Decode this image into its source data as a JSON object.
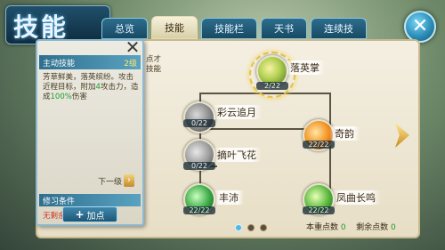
{
  "title": "技能",
  "tabs": [
    {
      "label": "总览"
    },
    {
      "label": "技能",
      "active": true
    },
    {
      "label": "技能栏"
    },
    {
      "label": "天书"
    },
    {
      "label": "连续技"
    }
  ],
  "info": {
    "header_left": "主动技能",
    "header_right": "2级",
    "desc_line1": "芳草鲜美，落英缤纷。攻击近程目标，附加",
    "desc_highlight_1": "4",
    "desc_line2": "攻击力，造成",
    "desc_highlight_2": "100%",
    "desc_line3": "伤害",
    "next_level": "下一级",
    "req_header": "修习条件",
    "req_text": "无剩余点数，无法修习",
    "add_button": "加点"
  },
  "partial_text": [
    "点才",
    "技能"
  ],
  "skills": [
    {
      "name": "落英掌",
      "count": "2/22",
      "color": "#8bb441"
    },
    {
      "name": "彩云追月",
      "count": "0/22",
      "color": "#9a9a9a"
    },
    {
      "name": "奇韵",
      "count": "22/22",
      "color": "#d4741b"
    },
    {
      "name": "摘叶飞花",
      "count": "0/22",
      "color": "#9a9a9a"
    },
    {
      "name": "丰沛",
      "count": "22/22",
      "color": "#3aa845"
    },
    {
      "name": "凤曲长鸣",
      "count": "22/22",
      "color": "#56b63b"
    }
  ],
  "points": {
    "current_label": "本重点数",
    "current_value": "0",
    "remain_label": "剩余点数",
    "remain_value": "0"
  },
  "pager": {
    "active_index": 0,
    "total": 3
  }
}
